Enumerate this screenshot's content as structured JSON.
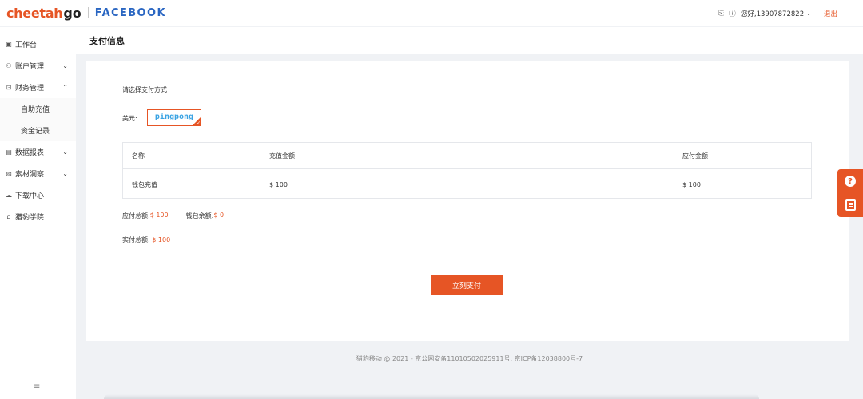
{
  "header": {
    "logo_brand": "cheetah",
    "logo_suffix": "go",
    "platform": "FACEBOOK",
    "greeting": "您好,13907872822",
    "logout": "退出"
  },
  "sidebar": {
    "items": [
      {
        "label": "工作台",
        "icon": "desktop-icon"
      },
      {
        "label": "账户管理",
        "icon": "user-icon",
        "chevron": "⌄"
      },
      {
        "label": "财务管理",
        "icon": "wallet-icon",
        "chevron": "⌃"
      },
      {
        "label": "数据报表",
        "icon": "chart-icon",
        "chevron": "⌄"
      },
      {
        "label": "素材洞察",
        "icon": "image-icon",
        "chevron": "⌄"
      },
      {
        "label": "下载中心",
        "icon": "cloud-download-icon"
      },
      {
        "label": "猎豹学院",
        "icon": "graduation-cap-icon"
      }
    ],
    "finance_sub": [
      "自助充值",
      "资金记录"
    ]
  },
  "page": {
    "title": "支付信息"
  },
  "payment": {
    "choose_label": "请选择支付方式",
    "currency_label": "美元:",
    "provider": "pingpong"
  },
  "table": {
    "headers": [
      "名称",
      "充值金额",
      "应付金额"
    ],
    "rows": [
      {
        "name": "钱包充值",
        "amount": "$ 100",
        "payable": "$ 100"
      }
    ]
  },
  "summary": {
    "total_payable_label": "应付总额:",
    "total_payable": "$ 100",
    "wallet_balance_label": "钱包余额:",
    "wallet_balance": "$ 0",
    "actual_total_label": "实付总额:",
    "actual_total": "$ 100"
  },
  "actions": {
    "pay_now": "立刻支付"
  },
  "footer": {
    "text": "猎豹移动 @ 2021 - 京公网安备11010502025911号, 京ICP备12038800号-7"
  },
  "colors": {
    "accent": "#e65525",
    "facebook_blue": "#2a66c2",
    "pingpong_blue": "#3aa3e3"
  }
}
